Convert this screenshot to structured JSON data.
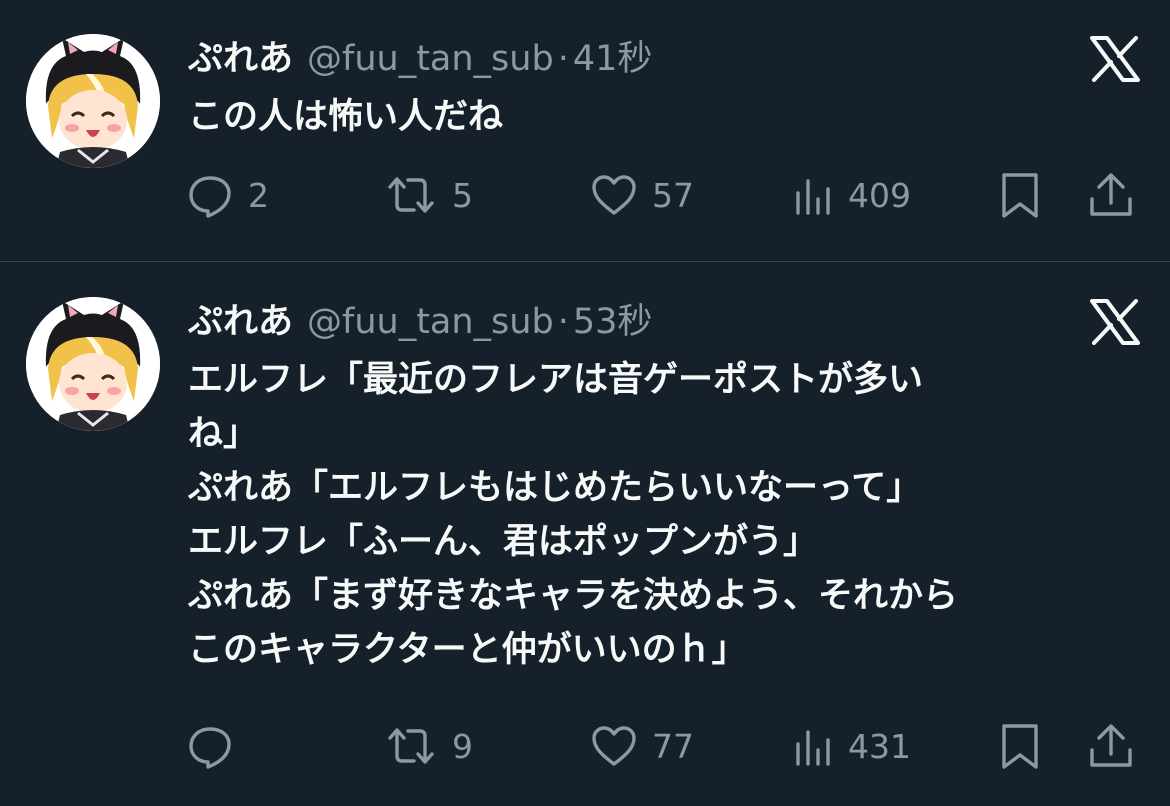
{
  "colors": {
    "background": "#15202b",
    "text_primary": "#f7f9f9",
    "text_secondary": "#8b98a5",
    "divider": "#38444d"
  },
  "tweets": [
    {
      "name": "ぷれあ",
      "handle": "@fuu_tan_sub",
      "separator": "·",
      "time": "41秒",
      "lines": [
        "この人は怖い人だね"
      ],
      "reply_count": "2",
      "retweet_count": "5",
      "like_count": "57",
      "view_count": "409"
    },
    {
      "name": "ぷれあ",
      "handle": "@fuu_tan_sub",
      "separator": "·",
      "time": "53秒",
      "lines": [
        "エルフレ「最近のフレアは音ゲーポストが多い",
        "ね」",
        "ぷれあ「エルフレもはじめたらいいなーって」",
        "エルフレ「ふーん、君はポップンがう」",
        "ぷれあ「まず好きなキャラを決めよう、それから",
        "このキャラクターと仲がいいのｈ」"
      ],
      "reply_count": "",
      "retweet_count": "9",
      "like_count": "77",
      "view_count": "431"
    }
  ],
  "icons": {
    "reply": "reply-bubble-icon",
    "retweet": "retweet-arrows-icon",
    "like": "heart-icon",
    "views": "bar-chart-icon",
    "bookmark": "bookmark-icon",
    "share": "share-upload-icon",
    "platform": "x-logo-icon",
    "avatar": "anime-girl-cat-hood-avatar"
  }
}
